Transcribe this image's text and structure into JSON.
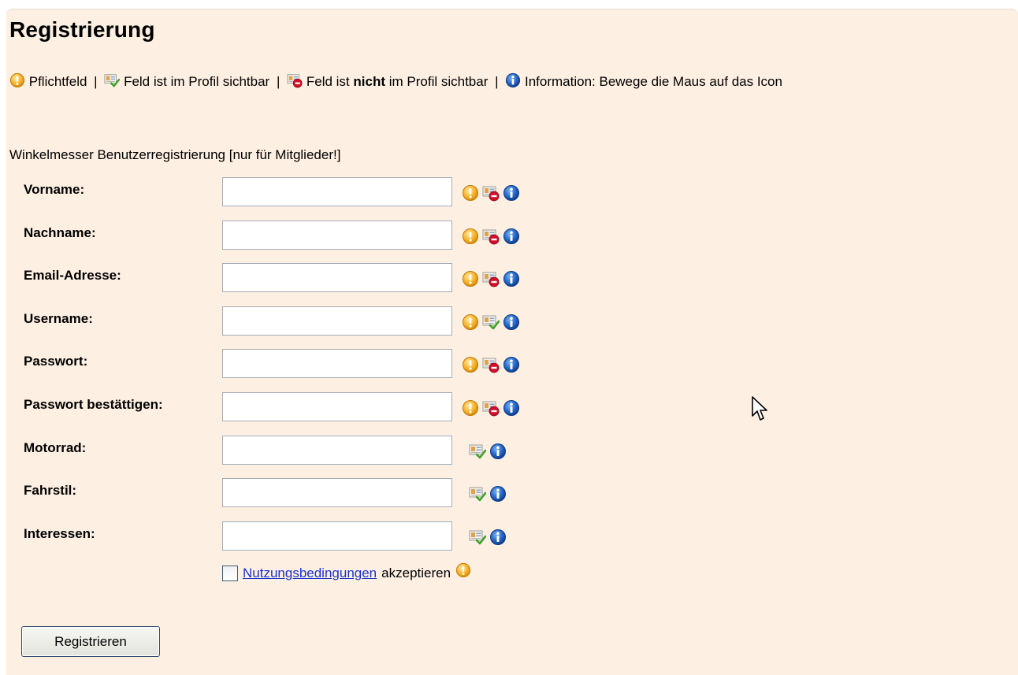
{
  "page": {
    "title": "Registrierung"
  },
  "legend": {
    "required": "Pflichtfeld",
    "sep": "|",
    "visible": "Feld ist im Profil sichtbar",
    "not_visible_pre": "Feld ist",
    "not_visible_bold": "nicht",
    "not_visible_post": "im Profil sichtbar",
    "info": "Information: Bewege die Maus auf das Icon"
  },
  "form": {
    "intro": "Winkelmesser Benutzerregistrierung [nur für Mitglieder!]",
    "fields": [
      {
        "label": "Vorname:",
        "value": "",
        "required": true,
        "visibility": "hidden"
      },
      {
        "label": "Nachname:",
        "value": "",
        "required": true,
        "visibility": "hidden"
      },
      {
        "label": "Email-Adresse:",
        "value": "",
        "required": true,
        "visibility": "hidden"
      },
      {
        "label": "Username:",
        "value": "",
        "required": true,
        "visibility": "visible"
      },
      {
        "label": "Passwort:",
        "value": "",
        "required": true,
        "visibility": "hidden"
      },
      {
        "label": "Passwort bestättigen:",
        "value": "",
        "required": true,
        "visibility": "hidden"
      },
      {
        "label": "Motorrad:",
        "value": "",
        "required": false,
        "visibility": "visible"
      },
      {
        "label": "Fahrstil:",
        "value": "",
        "required": false,
        "visibility": "visible"
      },
      {
        "label": "Interessen:",
        "value": "",
        "required": false,
        "visibility": "visible"
      }
    ],
    "terms_link": "Nutzungsbedingungen",
    "terms_text": "akzeptieren",
    "terms_checked": false,
    "submit_label": "Registrieren"
  },
  "icons": {
    "required": "exclamation-icon",
    "visible": "profile-visible-icon",
    "hidden": "profile-hidden-icon",
    "info": "info-icon"
  },
  "colors": {
    "panel_bg": "#fdf0e3",
    "link": "#1a33cc",
    "required_icon": "#f5a623",
    "info_icon": "#1f5fc4",
    "hidden_icon": "#d0102a"
  }
}
